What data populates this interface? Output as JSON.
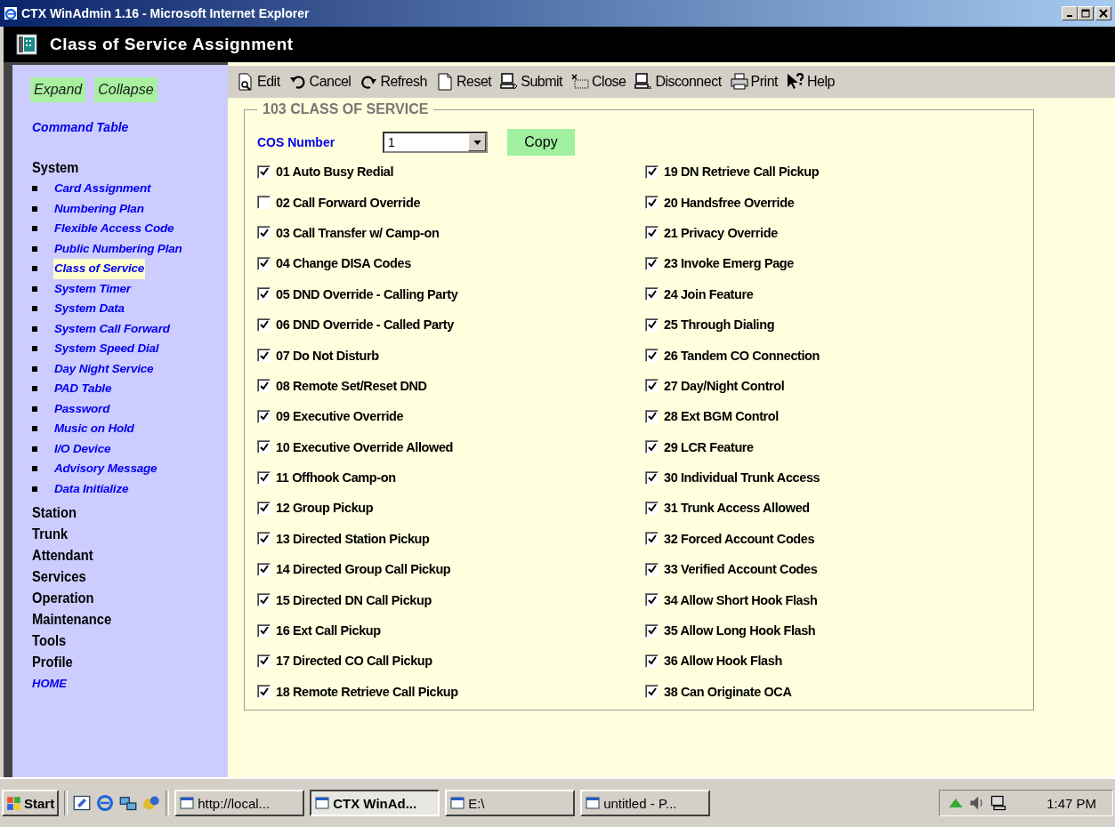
{
  "window": {
    "title": "CTX WinAdmin 1.16 - Microsoft Internet Explorer"
  },
  "app_header": {
    "title": "Class of Service Assignment"
  },
  "sidebar": {
    "buttons": [
      "Expand",
      "Collapse"
    ],
    "command_link": "Command Table",
    "groups": [
      {
        "label": "System",
        "children": [
          {
            "label": "Card Assignment",
            "selected": false
          },
          {
            "label": "Numbering Plan",
            "selected": false
          },
          {
            "label": "Flexible Access Code",
            "selected": false
          },
          {
            "label": "Public Numbering Plan",
            "selected": false
          },
          {
            "label": "Class of Service",
            "selected": true
          },
          {
            "label": "System Timer",
            "selected": false
          },
          {
            "label": "System Data",
            "selected": false
          },
          {
            "label": "System Call Forward",
            "selected": false
          },
          {
            "label": "System Speed Dial",
            "selected": false
          },
          {
            "label": "Day Night Service",
            "selected": false
          },
          {
            "label": "PAD Table",
            "selected": false
          },
          {
            "label": "Password",
            "selected": false
          },
          {
            "label": "Music on Hold",
            "selected": false
          },
          {
            "label": "I/O Device",
            "selected": false
          },
          {
            "label": "Advisory Message",
            "selected": false
          },
          {
            "label": "Data Initialize",
            "selected": false
          }
        ]
      },
      {
        "label": "Station"
      },
      {
        "label": "Trunk"
      },
      {
        "label": "Attendant"
      },
      {
        "label": "Services"
      },
      {
        "label": "Operation"
      },
      {
        "label": "Maintenance"
      },
      {
        "label": "Tools"
      },
      {
        "label": "Profile"
      }
    ],
    "home_link": "HOME"
  },
  "toolbar": [
    {
      "kind": "edit",
      "label": "Edit"
    },
    {
      "kind": "cancel",
      "label": "Cancel"
    },
    {
      "kind": "refresh",
      "label": "Refresh"
    },
    {
      "kind": "reset",
      "label": "Reset"
    },
    {
      "kind": "submit",
      "label": "Submit"
    },
    {
      "kind": "close",
      "label": "Close"
    },
    {
      "kind": "disconnect",
      "label": "Disconnect"
    },
    {
      "kind": "print",
      "label": "Print"
    },
    {
      "kind": "help",
      "label": "Help"
    }
  ],
  "form": {
    "legend": "103 CLASS OF SERVICE",
    "cos_label": "COS Number",
    "cos_value": "1",
    "copy_button": "Copy",
    "left_options": [
      {
        "label": "01 Auto Busy Redial",
        "checked": true
      },
      {
        "label": "02 Call Forward Override",
        "checked": false
      },
      {
        "label": "03 Call Transfer w/ Camp-on",
        "checked": true
      },
      {
        "label": "04 Change DISA Codes",
        "checked": true
      },
      {
        "label": "05 DND Override - Calling Party",
        "checked": true
      },
      {
        "label": "06 DND Override - Called Party",
        "checked": true
      },
      {
        "label": "07 Do Not Disturb",
        "checked": true
      },
      {
        "label": "08 Remote Set/Reset DND",
        "checked": true
      },
      {
        "label": "09 Executive Override",
        "checked": true
      },
      {
        "label": "10 Executive Override Allowed",
        "checked": true
      },
      {
        "label": "11 Offhook Camp-on",
        "checked": true
      },
      {
        "label": "12 Group Pickup",
        "checked": true
      },
      {
        "label": "13 Directed Station Pickup",
        "checked": true
      },
      {
        "label": "14 Directed Group Call Pickup",
        "checked": true
      },
      {
        "label": "15 Directed DN Call Pickup",
        "checked": true
      },
      {
        "label": "16 Ext Call Pickup",
        "checked": true
      },
      {
        "label": "17 Directed CO Call Pickup",
        "checked": true
      },
      {
        "label": "18 Remote Retrieve Call Pickup",
        "checked": true
      }
    ],
    "right_options": [
      {
        "label": "19 DN Retrieve Call Pickup",
        "checked": true
      },
      {
        "label": "20 Handsfree Override",
        "checked": true
      },
      {
        "label": "21 Privacy Override",
        "checked": true
      },
      {
        "label": "23 Invoke Emerg Page",
        "checked": true
      },
      {
        "label": "24 Join Feature",
        "checked": true
      },
      {
        "label": "25 Through Dialing",
        "checked": true
      },
      {
        "label": "26 Tandem CO Connection",
        "checked": true
      },
      {
        "label": "27 Day/Night Control",
        "checked": true
      },
      {
        "label": "28 Ext BGM Control",
        "checked": true
      },
      {
        "label": "29 LCR Feature",
        "checked": true
      },
      {
        "label": "30 Individual Trunk Access",
        "checked": true
      },
      {
        "label": "31 Trunk Access Allowed",
        "checked": true
      },
      {
        "label": "32 Forced Account Codes",
        "checked": true
      },
      {
        "label": "33 Verified Account Codes",
        "checked": true
      },
      {
        "label": "34 Allow Short Hook Flash",
        "checked": true
      },
      {
        "label": "35 Allow Long Hook Flash",
        "checked": true
      },
      {
        "label": "36 Allow Hook Flash",
        "checked": true
      },
      {
        "label": "38 Can Originate OCA",
        "checked": true
      }
    ]
  },
  "taskbar": {
    "start": "Start",
    "tasks": [
      {
        "label": "http://local...",
        "selected": false
      },
      {
        "label": "CTX WinAd...",
        "selected": true
      },
      {
        "label": "E:\\",
        "selected": false
      },
      {
        "label": "untitled - P...",
        "selected": false
      }
    ],
    "clock": "1:47 PM"
  }
}
